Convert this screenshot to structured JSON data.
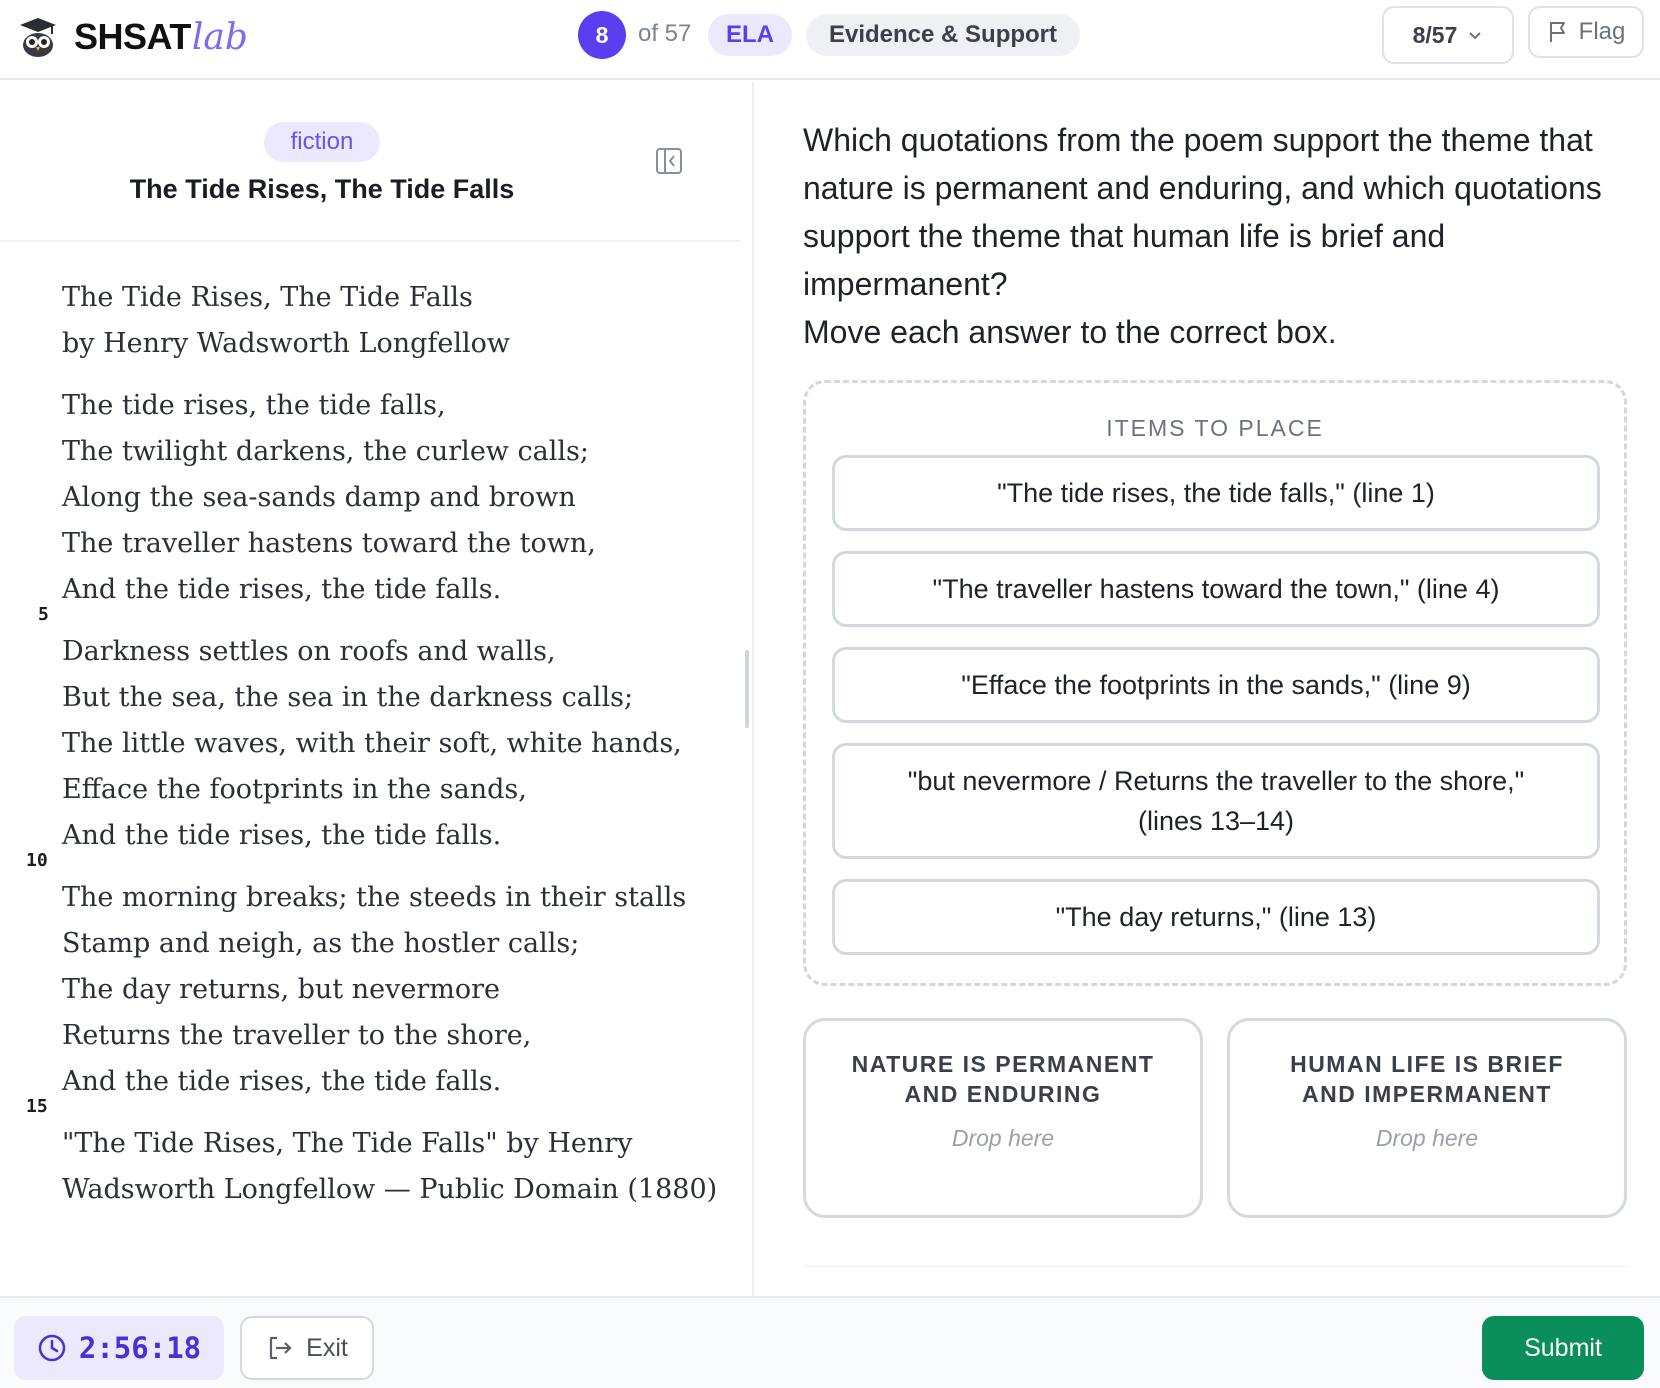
{
  "app": {
    "brand_main": "SHSAT",
    "brand_accent": "lab"
  },
  "header": {
    "question_number": "8",
    "question_of": "of 57",
    "subject": "ELA",
    "skill": "Evidence & Support",
    "nav_label": "8/57",
    "flag_label": "Flag"
  },
  "passage": {
    "genre": "fiction",
    "title": "The Tide Rises, The Tide Falls",
    "heading_line1": "The Tide Rises, The Tide Falls",
    "heading_line2": "by Henry Wadsworth Longfellow",
    "stanzas": [
      [
        "The tide rises, the tide falls,",
        "The twilight darkens, the curlew calls;",
        "Along the sea-sands damp and brown",
        "The traveller hastens toward the town,",
        "And the tide rises, the tide falls."
      ],
      [
        "Darkness settles on roofs and walls,",
        "But the sea, the sea in the darkness calls;",
        "The little waves, with their soft, white hands,",
        "Efface the footprints in the sands,",
        "And the tide rises, the tide falls."
      ],
      [
        "The morning breaks; the steeds in their stalls",
        "Stamp and neigh, as the hostler calls;",
        "The day returns, but nevermore",
        "Returns the traveller to the shore,",
        "And the tide rises, the tide falls."
      ]
    ],
    "line_numbers": [
      "5",
      "10",
      "15"
    ],
    "source_line1": "\"The Tide Rises, The Tide Falls\" by Henry",
    "source_line2": "Wadsworth Longfellow — Public Domain (1880)"
  },
  "question": {
    "prompt": "Which quotations from the poem support the theme that nature is permanent and enduring, and which quotations support the theme that human life is brief and impermanent?",
    "instruction": "Move each answer to the correct box."
  },
  "bank": {
    "label": "ITEMS TO PLACE",
    "items": [
      "\"The tide rises, the tide falls,\" (line 1)",
      "\"The traveller hastens toward the town,\" (line 4)",
      "\"Efface the footprints in the sands,\" (line 9)",
      "\"but nevermore / Returns the traveller to the shore,\" (lines 13–14)",
      "\"The day returns,\" (line 13)"
    ]
  },
  "dropzones": [
    {
      "title": "NATURE IS PERMANENT AND ENDURING",
      "hint": "Drop here"
    },
    {
      "title": "HUMAN LIFE IS BRIEF AND IMPERMANENT",
      "hint": "Drop here"
    }
  ],
  "footer": {
    "timer": "2:56:18",
    "exit_label": "Exit",
    "submit_label": "Submit"
  },
  "colors": {
    "accent": "#5b3ef0",
    "accent_soft": "#ece8fe",
    "submit": "#0a8f5c"
  },
  "icons": [
    "owl-logo-icon",
    "chevron-down-icon",
    "flag-icon",
    "collapse-panel-icon",
    "clock-icon",
    "exit-icon"
  ]
}
